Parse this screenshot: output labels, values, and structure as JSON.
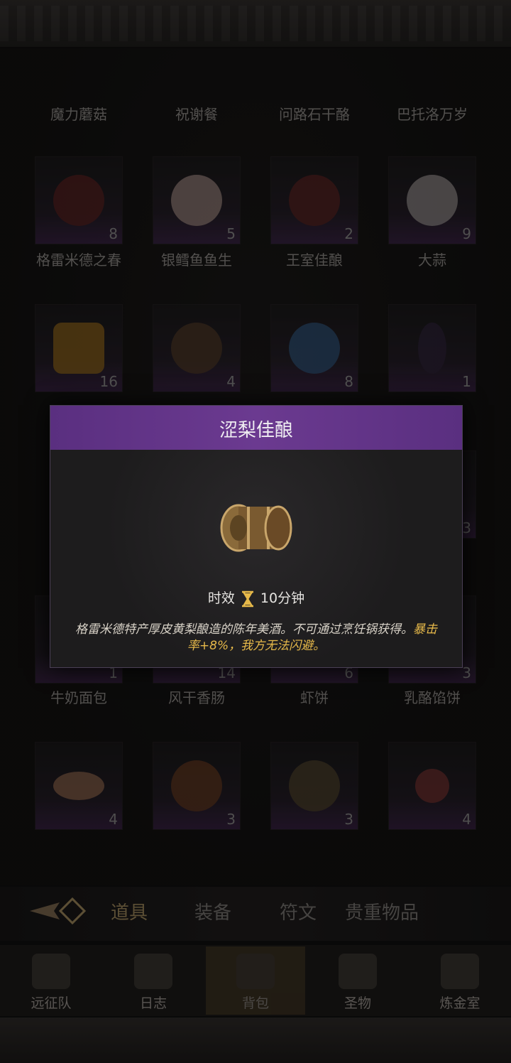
{
  "row1_labels": [
    "魔力蘑菇",
    "祝谢餐",
    "问路石干酪",
    "巴托洛万岁"
  ],
  "row2": [
    {
      "label": "格雷米德之春",
      "count": "8",
      "icon": "wine-glass-icon",
      "color": "#7a2a2a"
    },
    {
      "label": "银鳕鱼鱼生",
      "count": "5",
      "icon": "fish-plate-icon",
      "color": "#d8b8b0"
    },
    {
      "label": "王室佳酿",
      "count": "2",
      "icon": "wine-glass-icon",
      "color": "#7a2a2a"
    },
    {
      "label": "大蒜",
      "count": "9",
      "icon": "garlic-icon",
      "color": "#cfc7c7"
    }
  ],
  "row3": [
    {
      "label": "",
      "count": "16",
      "icon": "honey-jar-icon",
      "color": "#c88b22"
    },
    {
      "label": "",
      "count": "4",
      "icon": "pinecone-icon",
      "color": "#6a4a32"
    },
    {
      "label": "",
      "count": "8",
      "icon": "blue-potion-icon",
      "color": "#3d6fa8"
    },
    {
      "label": "",
      "count": "1",
      "icon": "dark-potion-icon",
      "color": "#3c2b4e"
    }
  ],
  "row4_counts": [
    "",
    "",
    "",
    "3"
  ],
  "row5": [
    {
      "label": "牛奶面包",
      "count": "1"
    },
    {
      "label": "风干香肠",
      "count": "14"
    },
    {
      "label": "虾饼",
      "count": "6"
    },
    {
      "label": "乳酪馅饼",
      "count": "3"
    }
  ],
  "row6": [
    {
      "count": "4",
      "icon": "shrimp-plate-icon",
      "color": "#c68a6a"
    },
    {
      "count": "3",
      "icon": "stew-bowl-icon",
      "color": "#8a4a2a"
    },
    {
      "count": "3",
      "icon": "soup-bowl-icon",
      "color": "#6a5a3a"
    },
    {
      "count": "4",
      "icon": "pudding-icon",
      "color": "#a04040"
    }
  ],
  "tabs": [
    "道具",
    "装备",
    "符文",
    "贵重物品"
  ],
  "nav": [
    "远征队",
    "日志",
    "背包",
    "圣物",
    "炼金室"
  ],
  "modal": {
    "title": "涩梨佳酿",
    "duration_label": "时效",
    "duration_value": "10分钟",
    "desc_plain": "格雷米德特产厚皮黄梨酿造的陈年美酒。不可通过烹饪锅获得。",
    "desc_highlight": "暴击率+8%，我方无法闪避。"
  },
  "colors": {
    "accent_purple": "#6b3a90",
    "highlight_gold": "#e7b94a"
  }
}
